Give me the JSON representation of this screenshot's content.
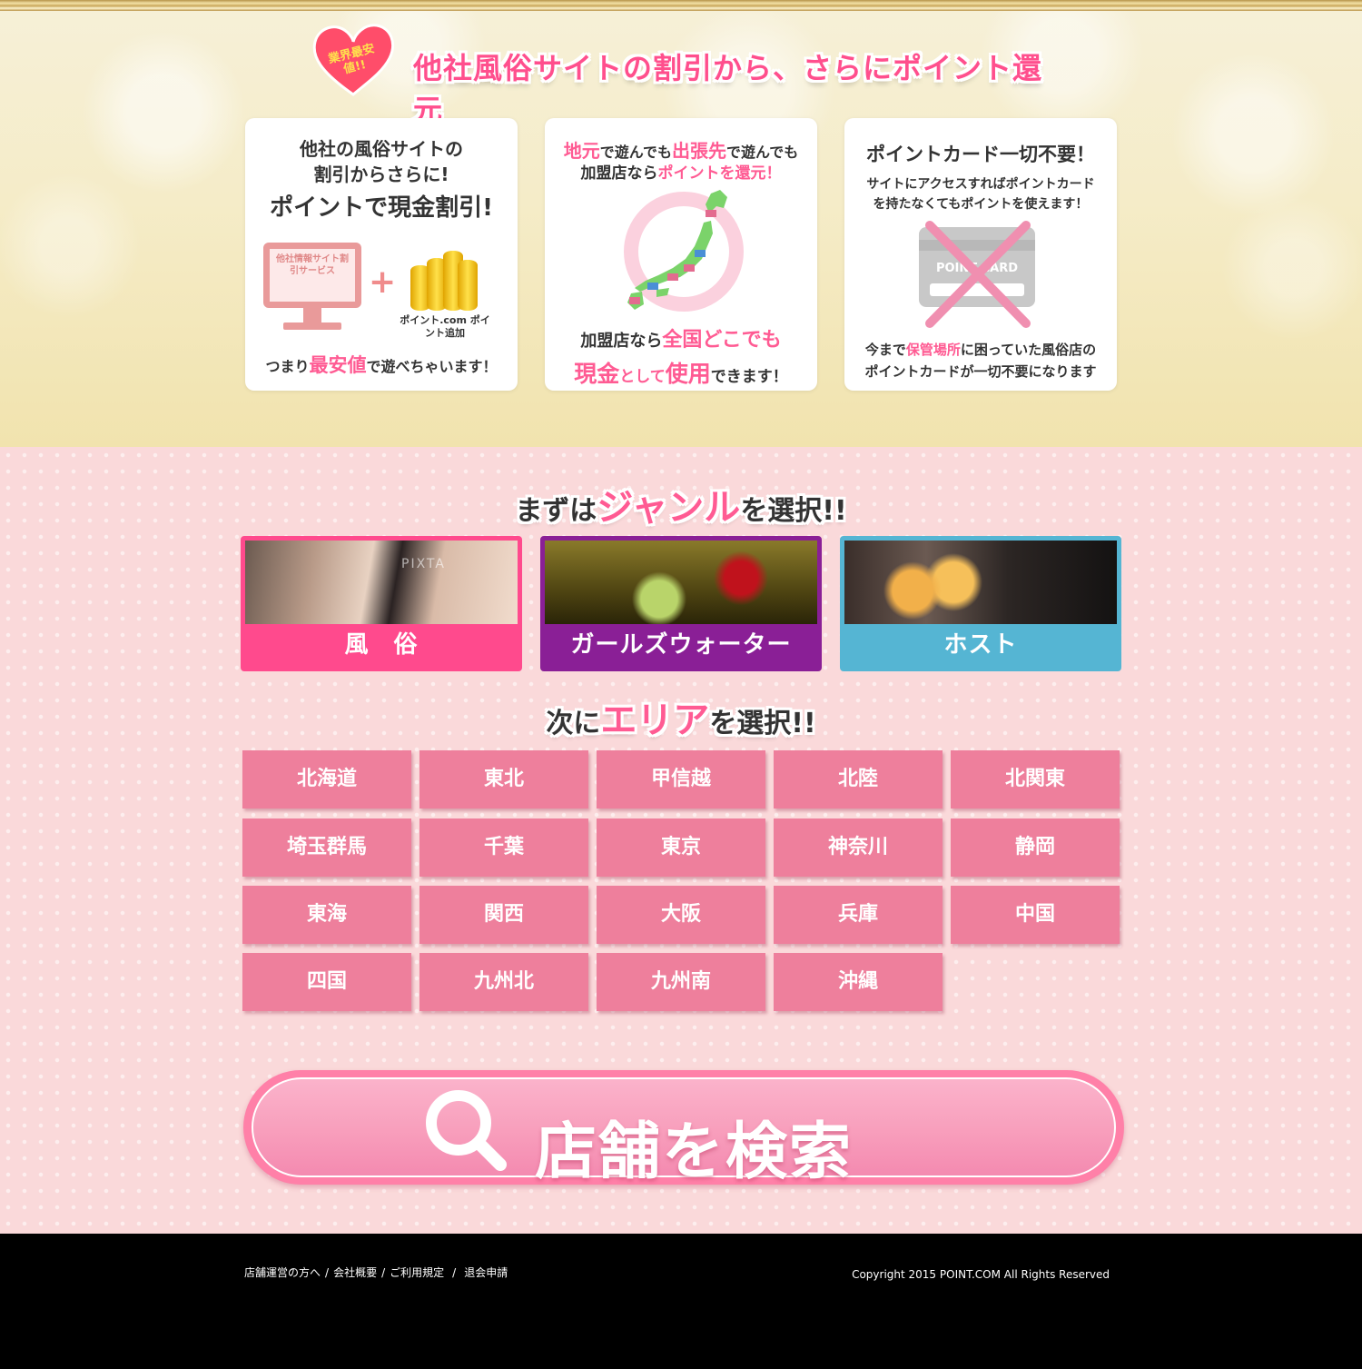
{
  "hero": {
    "badge": "業界最安値!!",
    "headline": "他社風俗サイトの割引から、さらにポイント還元"
  },
  "cards": [
    {
      "line1": "他社の風俗サイトの",
      "line2": "割引からさらに!",
      "emph": "ポイントで現金割引!",
      "monitor_text": "他社情報サイト割引サービス",
      "plus": "+",
      "coin_caption": "ポイント.com ポイント追加",
      "bottom_pre": "つまり",
      "bottom_emph": "最安値",
      "bottom_post": "で遊べちゃいます！"
    },
    {
      "l1_a": "地元",
      "l1_b": "で遊んでも",
      "l1_c": "出張先",
      "l1_d": "で遊んでも",
      "l2_a": "加盟店なら",
      "l2_b": "ポイントを還元！",
      "b1_a": "加盟店なら",
      "b1_b": "全国どこでも",
      "b2_a": "現金",
      "b2_b": "として",
      "b2_c": "使用",
      "b2_d": "できます！"
    },
    {
      "title": "ポイントカード一切不要！",
      "desc1": "サイトにアクセスすればポイントカード",
      "desc2": "を持たなくてもポイントを使えます！",
      "card_text": "POINT CARD",
      "b1_a": "今まで",
      "b1_b": "保管場所",
      "b1_c": "に困っていた風俗店の",
      "b2": "ポイントカードが一切不要になります"
    }
  ],
  "genre_section": {
    "pre": "まずは",
    "big": "ジャンル",
    "post": "を選択!!"
  },
  "genres": [
    {
      "label": "風　俗",
      "color": "#ff4a8d",
      "watermark": "PIXTA"
    },
    {
      "label": "ガールズウォーター",
      "color": "#8a1f96"
    },
    {
      "label": "ホスト",
      "color": "#55b5d3"
    }
  ],
  "area_section": {
    "pre": "次に",
    "big": "エリア",
    "post": "を選択!!"
  },
  "areas": [
    "北海道",
    "東北",
    "甲信越",
    "北陸",
    "北関東",
    "埼玉群馬",
    "千葉",
    "東京",
    "神奈川",
    "静岡",
    "東海",
    "関西",
    "大阪",
    "兵庫",
    "中国",
    "四国",
    "九州北",
    "九州南",
    "沖縄"
  ],
  "search": {
    "label": "店舗を検索"
  },
  "footer": {
    "links": [
      "店舗運営の方へ",
      "会社概要",
      "ご利用規定",
      "退会申請"
    ],
    "copyright": "Copyright 2015 POINT.COM All Rights Reserved"
  }
}
